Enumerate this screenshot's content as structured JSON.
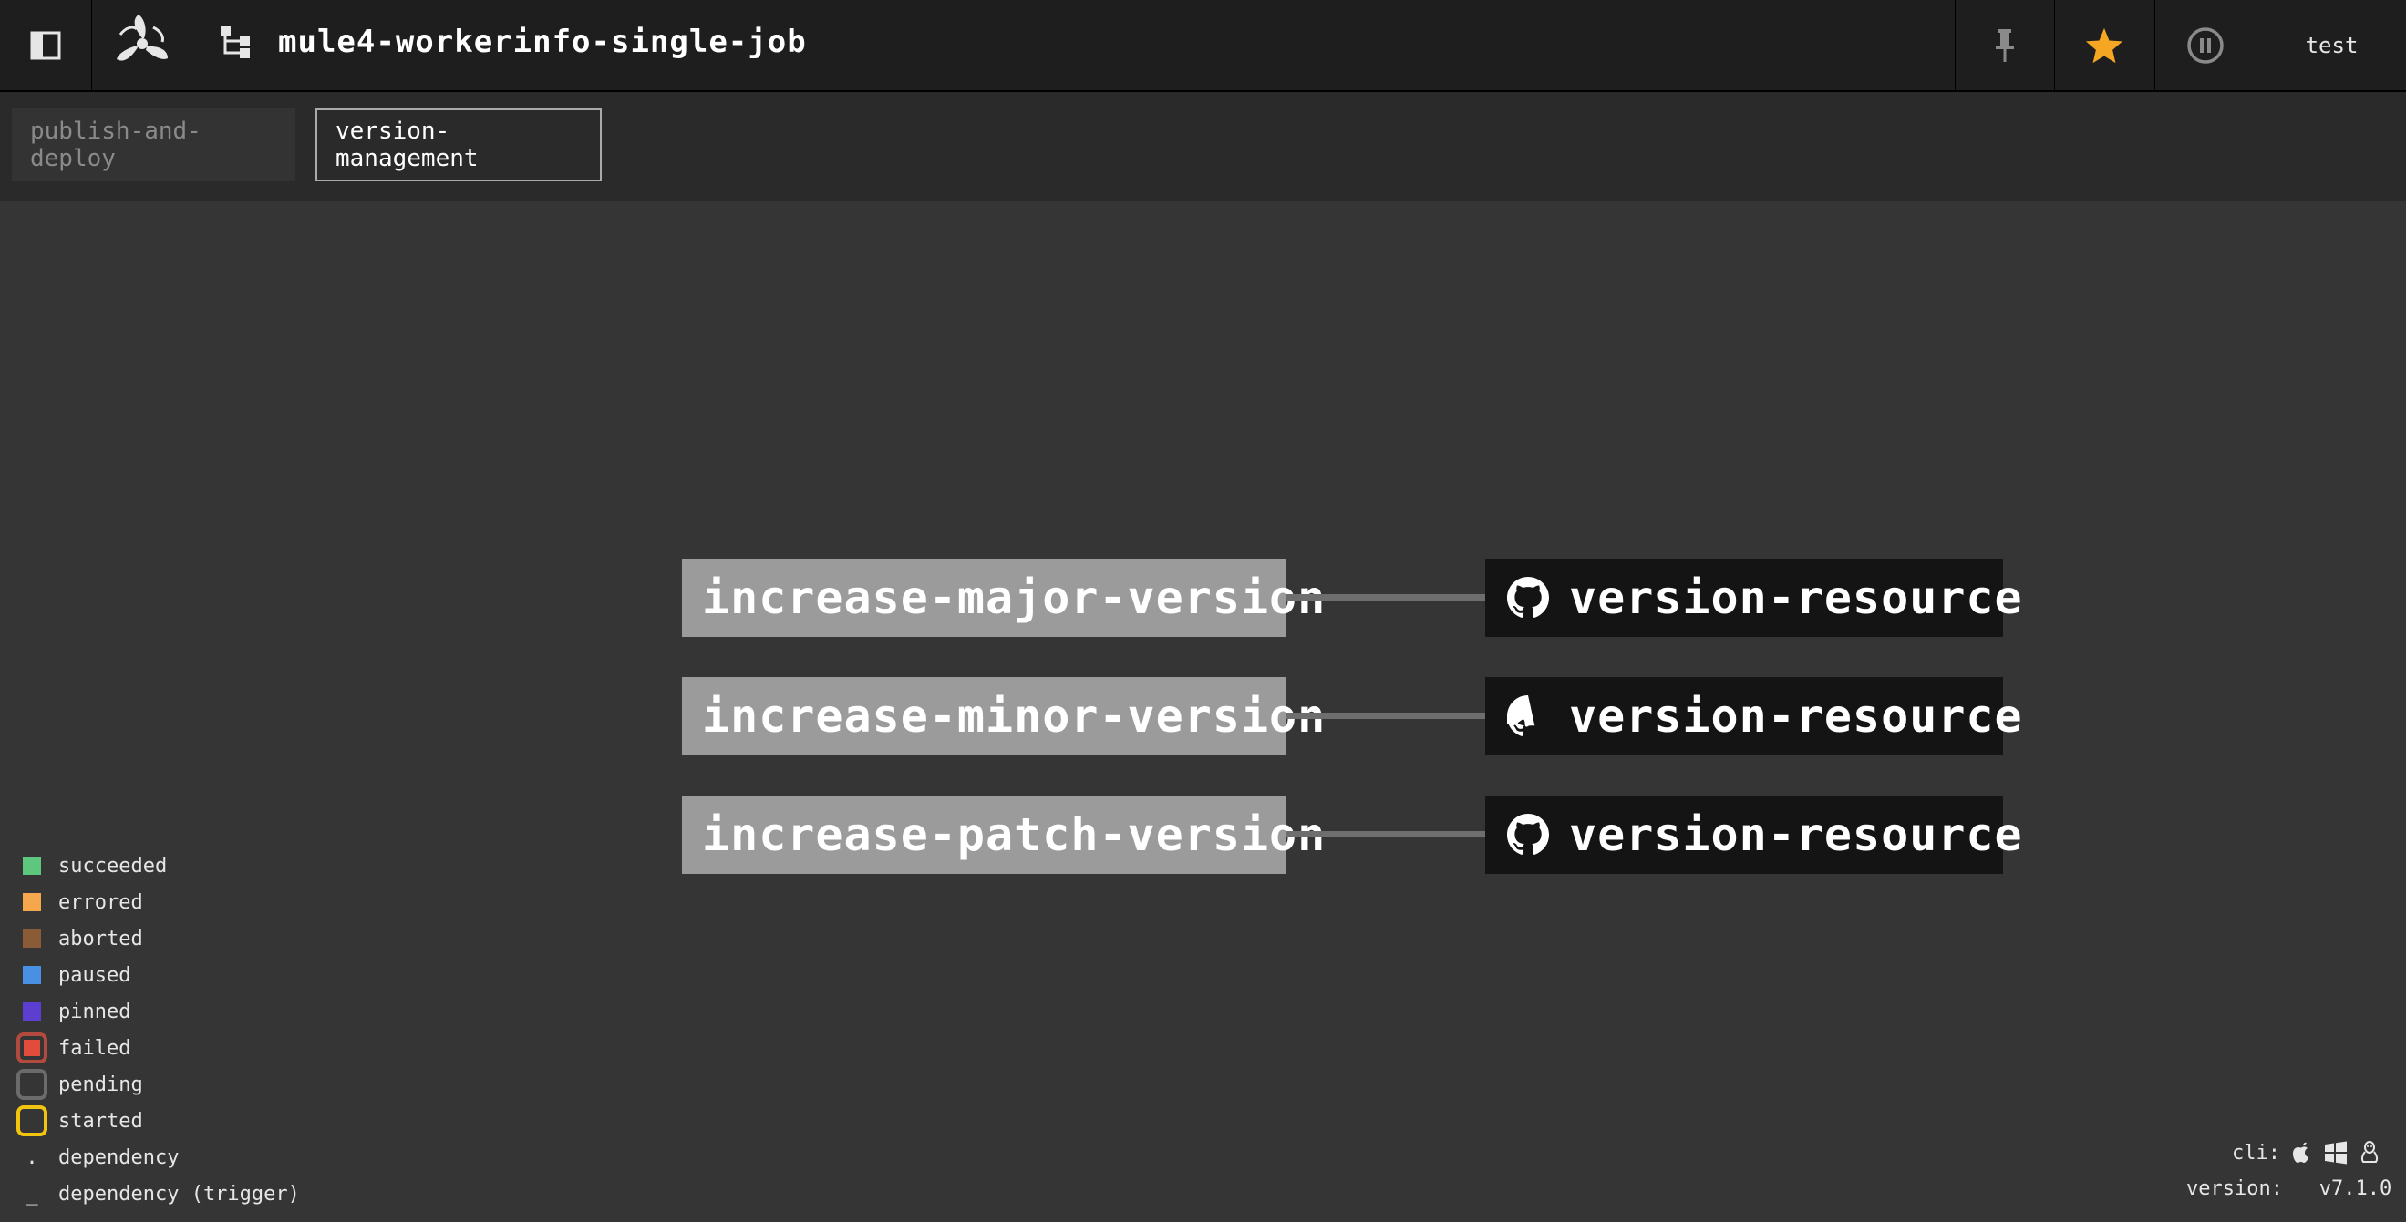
{
  "topbar": {
    "sidebar_toggle_icon": "sidebar-panel-icon",
    "logo_icon": "concourse-propeller-icon",
    "pipeline_icon": "pipeline-tree-icon",
    "pipeline_name": "mule4-workerinfo-single-job",
    "pin_icon": "pin-icon",
    "favorite_icon": "star-icon",
    "favorite_color": "#f5a623",
    "pause_icon": "pause-circle-icon",
    "user": "test"
  },
  "groups": [
    {
      "label": "publish-and-deploy",
      "active": false
    },
    {
      "label": "version-management",
      "active": true
    }
  ],
  "graph": {
    "jobs": [
      {
        "name": "increase-major-version"
      },
      {
        "name": "increase-minor-version"
      },
      {
        "name": "increase-patch-version"
      }
    ],
    "resources": [
      {
        "name": "version-resource",
        "icon": "github-icon"
      },
      {
        "name": "version-resource",
        "icon": "github-icon"
      },
      {
        "name": "version-resource",
        "icon": "github-icon"
      }
    ]
  },
  "legend": [
    {
      "label": "succeeded",
      "color": "#5ec77e"
    },
    {
      "label": "errored",
      "color": "#f5a74d"
    },
    {
      "label": "aborted",
      "color": "#8b5a37"
    },
    {
      "label": "paused",
      "color": "#4a90e2"
    },
    {
      "label": "pinned",
      "color": "#5c3fd1"
    },
    {
      "label": "failed",
      "color": "#e24c3d"
    },
    {
      "label": "pending",
      "color": "#6b6b6b"
    },
    {
      "label": "started",
      "color": "#f1c40f"
    },
    {
      "label": "dependency"
    },
    {
      "label": "dependency (trigger)"
    }
  ],
  "footer": {
    "cli_label": "cli:",
    "cli_icons": [
      "apple-icon",
      "windows-icon",
      "linux-icon"
    ],
    "version_label": "version:",
    "version_value": "v7.1.0"
  }
}
